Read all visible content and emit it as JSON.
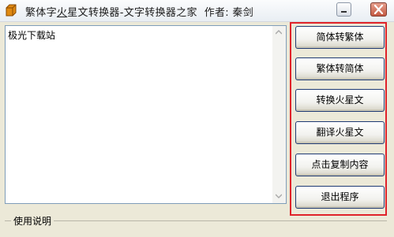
{
  "window": {
    "title_pre": "繁体字",
    "title_hl": "火",
    "title_post": "星文转换器-文字转换器之家",
    "author_label": "作者:",
    "author_name": "秦剑"
  },
  "editor": {
    "text": "极光下载站"
  },
  "buttons": {
    "simplified_to_traditional": "简体转繁体",
    "traditional_to_simplified": "繁体转简体",
    "to_martian": "转换火星文",
    "translate_martian": "翻译火星文",
    "copy_content": "点击复制内容",
    "exit": "退出程序"
  },
  "usage": {
    "title": "使用说明"
  },
  "colors": {
    "highlight_border": "#e0232a",
    "window_bg": "#ece9d8"
  }
}
